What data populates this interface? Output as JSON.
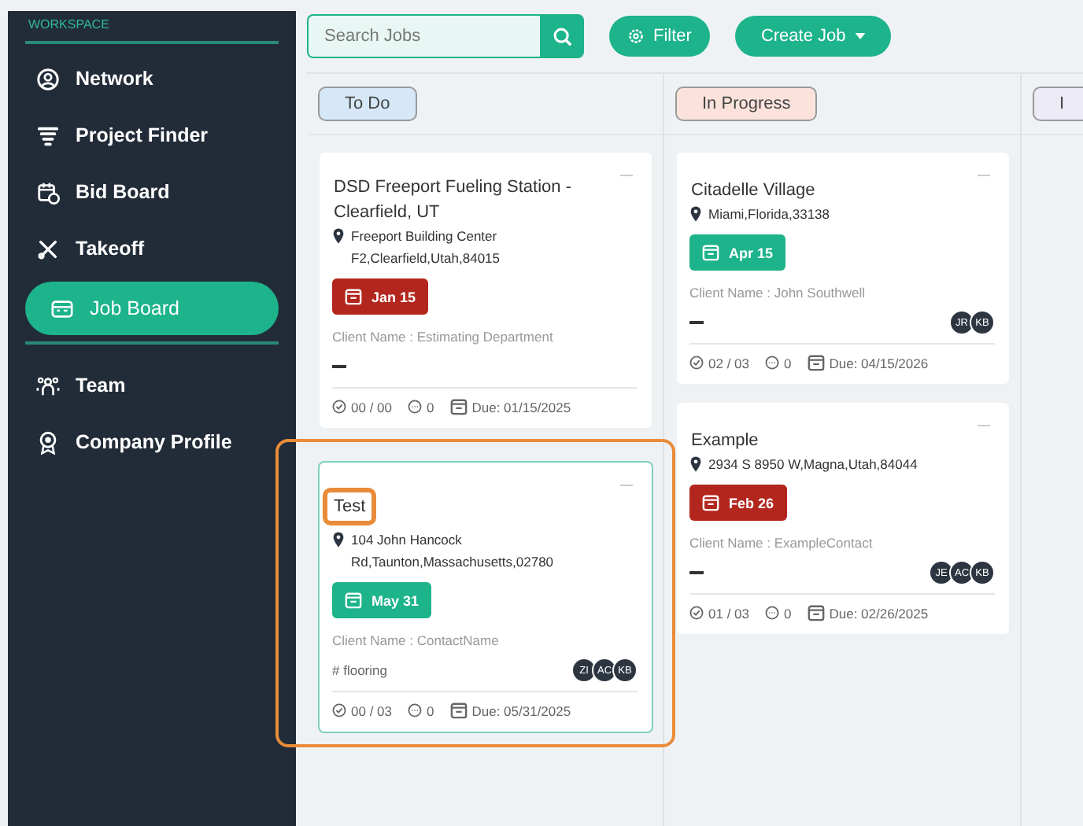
{
  "sidebar": {
    "heading": "WORKSPACE",
    "sections": [
      [
        {
          "label": "Network",
          "selected": false
        },
        {
          "label": "Project Finder",
          "selected": false
        },
        {
          "label": "Bid Board",
          "selected": false
        },
        {
          "label": "Takeoff",
          "selected": false
        },
        {
          "label": "Job Board",
          "selected": true
        }
      ],
      [
        {
          "label": "Team",
          "selected": false
        },
        {
          "label": "Company Profile",
          "selected": false
        }
      ]
    ]
  },
  "toolbar": {
    "search": {
      "placeholder": "Search Jobs"
    },
    "filter_button": "Filter",
    "create_button": "Create Job"
  },
  "columns": [
    {
      "title": "To Do",
      "color": "#d6e8f7",
      "cards": [
        {
          "title": "DSD Freeport Fueling Station - Clearfield, UT",
          "location": "Freeport Building Center F2,Clearfield,Utah,84015",
          "date": "Jan 15",
          "color": "#b3261e",
          "client": "Client Name : Estimating Department",
          "checks": "00 / 00",
          "comments": "0",
          "due": "Due: 01/15/2025"
        },
        {
          "title": "Test",
          "location": "104 John Hancock Rd,Taunton,Massachusetts,02780",
          "date": "May 31",
          "color": "#1db38b",
          "client": "Client Name : ContactName",
          "tag": "# flooring",
          "avatars": [
            "ZI",
            "AC",
            "KB"
          ],
          "checks": "00 / 03",
          "comments": "0",
          "due": "Due: 05/31/2025",
          "annotated": true,
          "title_annotated": true
        }
      ]
    },
    {
      "title": "In Progress",
      "color": "#fbe3dc",
      "cards": [
        {
          "title": "Citadelle Village",
          "location": "Miami,Florida,33138",
          "date": "Apr 15",
          "color": "#1db38b",
          "client": "Client Name : John Southwell",
          "avatars": [
            "JR",
            "KB"
          ],
          "checks": "02 / 03",
          "comments": "0",
          "due": "Due: 04/15/2026"
        },
        {
          "title": "Example",
          "location": "2934 S 8950 W,Magna,Utah,84044",
          "date": "Feb 26",
          "color": "#b3261e",
          "client": "Client Name : ExampleContact",
          "avatars": [
            "JE",
            "AC",
            "KB"
          ],
          "checks": "01 / 03",
          "comments": "0",
          "due": "Due: 02/26/2025"
        }
      ]
    },
    {
      "title": "I",
      "color": "#ecebf5"
    }
  ]
}
